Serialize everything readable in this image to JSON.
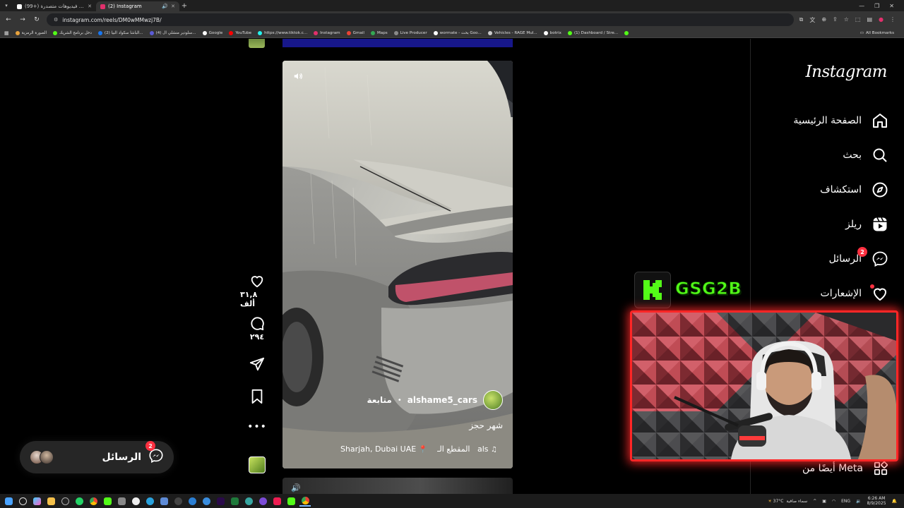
{
  "browser": {
    "tabs": [
      {
        "title": "(99+) شاهد فيديوهات متصدرة |",
        "active": false,
        "favicon_color": "#ffffff"
      },
      {
        "title": "(2) Instagram",
        "active": true,
        "favicon_color": "#e1306c"
      }
    ],
    "url": "instagram.com/reels/DM0wMMwzj7B/",
    "bookmarks": [
      {
        "label": "الصورة الرمزية",
        "color": "#e8a33d"
      },
      {
        "label": "دخل برنامج الشريك",
        "color": "#53fc18"
      },
      {
        "label": "(2) الباشا سكواد البيا...",
        "color": "#1877f2"
      },
      {
        "label": "(4) سلودير منشلي ال...",
        "color": "#5b5bd6"
      },
      {
        "label": "Google",
        "color": "#ffffff"
      },
      {
        "label": "YouTube",
        "color": "#ff0000"
      },
      {
        "label": "https://www.tiktok.c...",
        "color": "#25f4ee"
      },
      {
        "label": "Instagram",
        "color": "#e1306c"
      },
      {
        "label": "Gmail",
        "color": "#ea4335"
      },
      {
        "label": "Maps",
        "color": "#34a853"
      },
      {
        "label": "Live Producer",
        "color": "#8a8a8a"
      },
      {
        "label": "wormate - بحث Goo...",
        "color": "#ffffff"
      },
      {
        "label": "Vehicles - RAGE Mul...",
        "color": "#cccccc"
      },
      {
        "label": "botrix",
        "color": "#ffffff"
      },
      {
        "label": "(1) Dashboard / Stre...",
        "color": "#53fc18"
      },
      {
        "label": "",
        "color": "#53fc18"
      }
    ],
    "all_bookmarks_label": "All Bookmarks"
  },
  "reel": {
    "username": "alshame5_cars",
    "follow_label": "متابعة",
    "caption": "شهر حجز",
    "audio_label": "als",
    "audio_name": "المقطع الـ",
    "location": "Sharjah, Dubai UAE"
  },
  "actions": {
    "likes": "٣١,٨ ألف",
    "comments": "٢٩٤"
  },
  "sidebar": {
    "logo": "Instagram",
    "items": [
      {
        "label": "الصفحة الرئيسية",
        "icon": "home-icon"
      },
      {
        "label": "بحث",
        "icon": "search-icon"
      },
      {
        "label": "استكشاف",
        "icon": "explore-icon"
      },
      {
        "label": "ريلز",
        "icon": "reels-icon"
      },
      {
        "label": "الرسائل",
        "icon": "messenger-icon",
        "badge": "2"
      },
      {
        "label": "الإشعارات",
        "icon": "heart-icon"
      }
    ],
    "meta_label": "أيضًا من Meta"
  },
  "messages_pill": {
    "label": "الرسائل",
    "badge": "2"
  },
  "overlay": {
    "streamer_name": "GSG2B",
    "kick_letter": "K",
    "accent": "#53fc18",
    "frame": "#ff2626"
  },
  "taskbar": {
    "weather": "37°C",
    "weather_desc": "سماء صافية",
    "lang": "ENG",
    "time": "6:26 AM",
    "date": "8/9/2025"
  }
}
